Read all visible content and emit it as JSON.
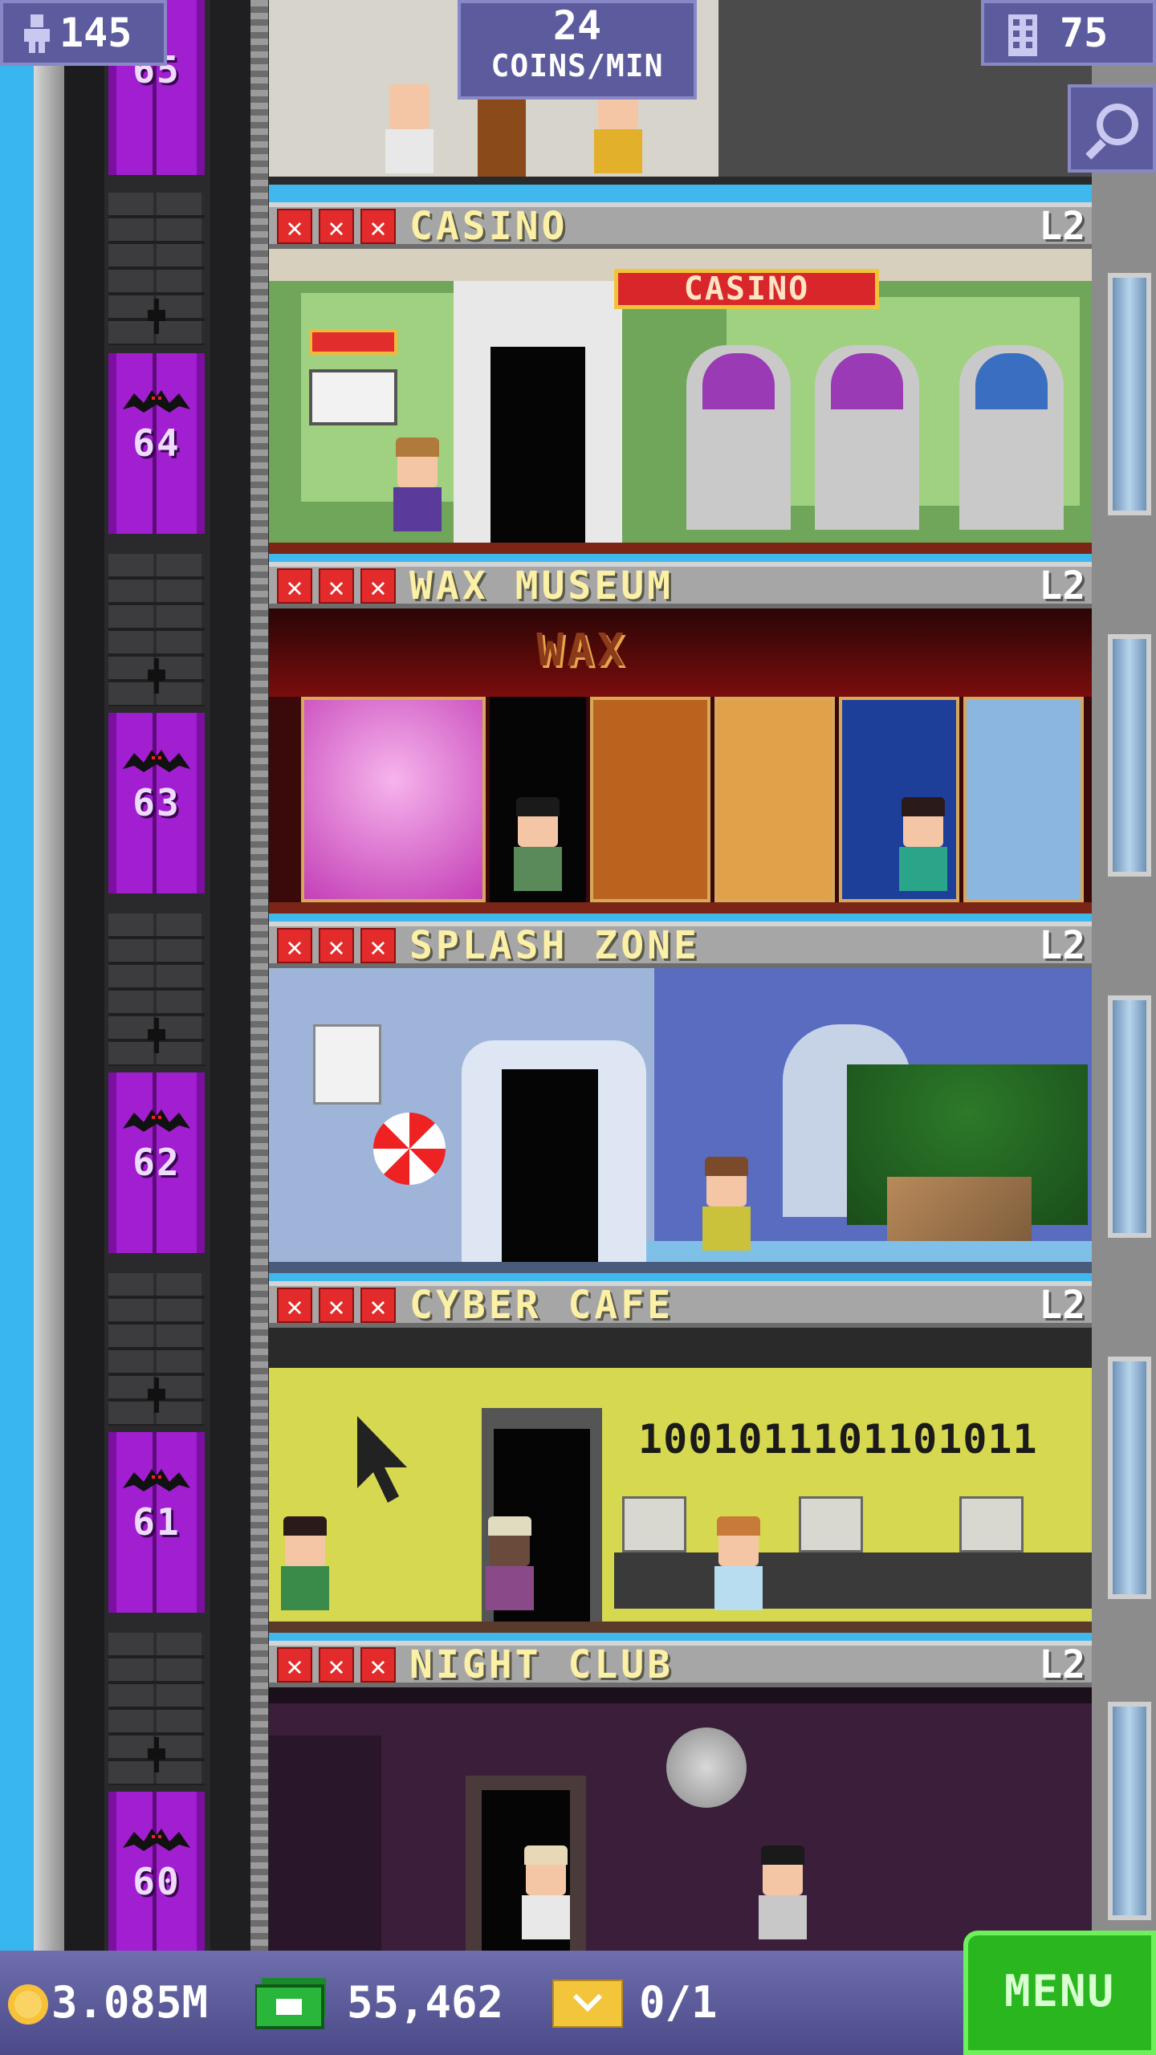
{
  "hud": {
    "population": "145",
    "coins_rate": "24",
    "coins_unit": "COINS/MIN",
    "floors": "75"
  },
  "top_floor_number": "65",
  "floors": [
    {
      "number": "64",
      "name": "CASINO",
      "level": "L2",
      "sign": "CASINO"
    },
    {
      "number": "63",
      "name": "WAX MUSEUM",
      "level": "L2",
      "sign": "WAX"
    },
    {
      "number": "62",
      "name": "SPLASH ZONE",
      "level": "L2"
    },
    {
      "number": "61",
      "name": "CYBER CAFE",
      "level": "L2",
      "sign": "1001011101101011"
    },
    {
      "number": "60",
      "name": "NIGHT CLUB",
      "level": "L2"
    }
  ],
  "bottom": {
    "coins": "3.085M",
    "bux": "55,462",
    "tickets": "0/1",
    "menu_label": "MENU"
  },
  "icons": [
    "person-icon",
    "building-icon",
    "magnifier-icon",
    "coin-icon",
    "bux-icon",
    "ticket-icon",
    "bat-icon"
  ],
  "colors": {
    "elevator": "#a21fd1",
    "floor_name": "#fbf0a6",
    "star_empty": "#e32b2b",
    "menu": "#2ab61f",
    "hud": "#5c5b9d"
  }
}
